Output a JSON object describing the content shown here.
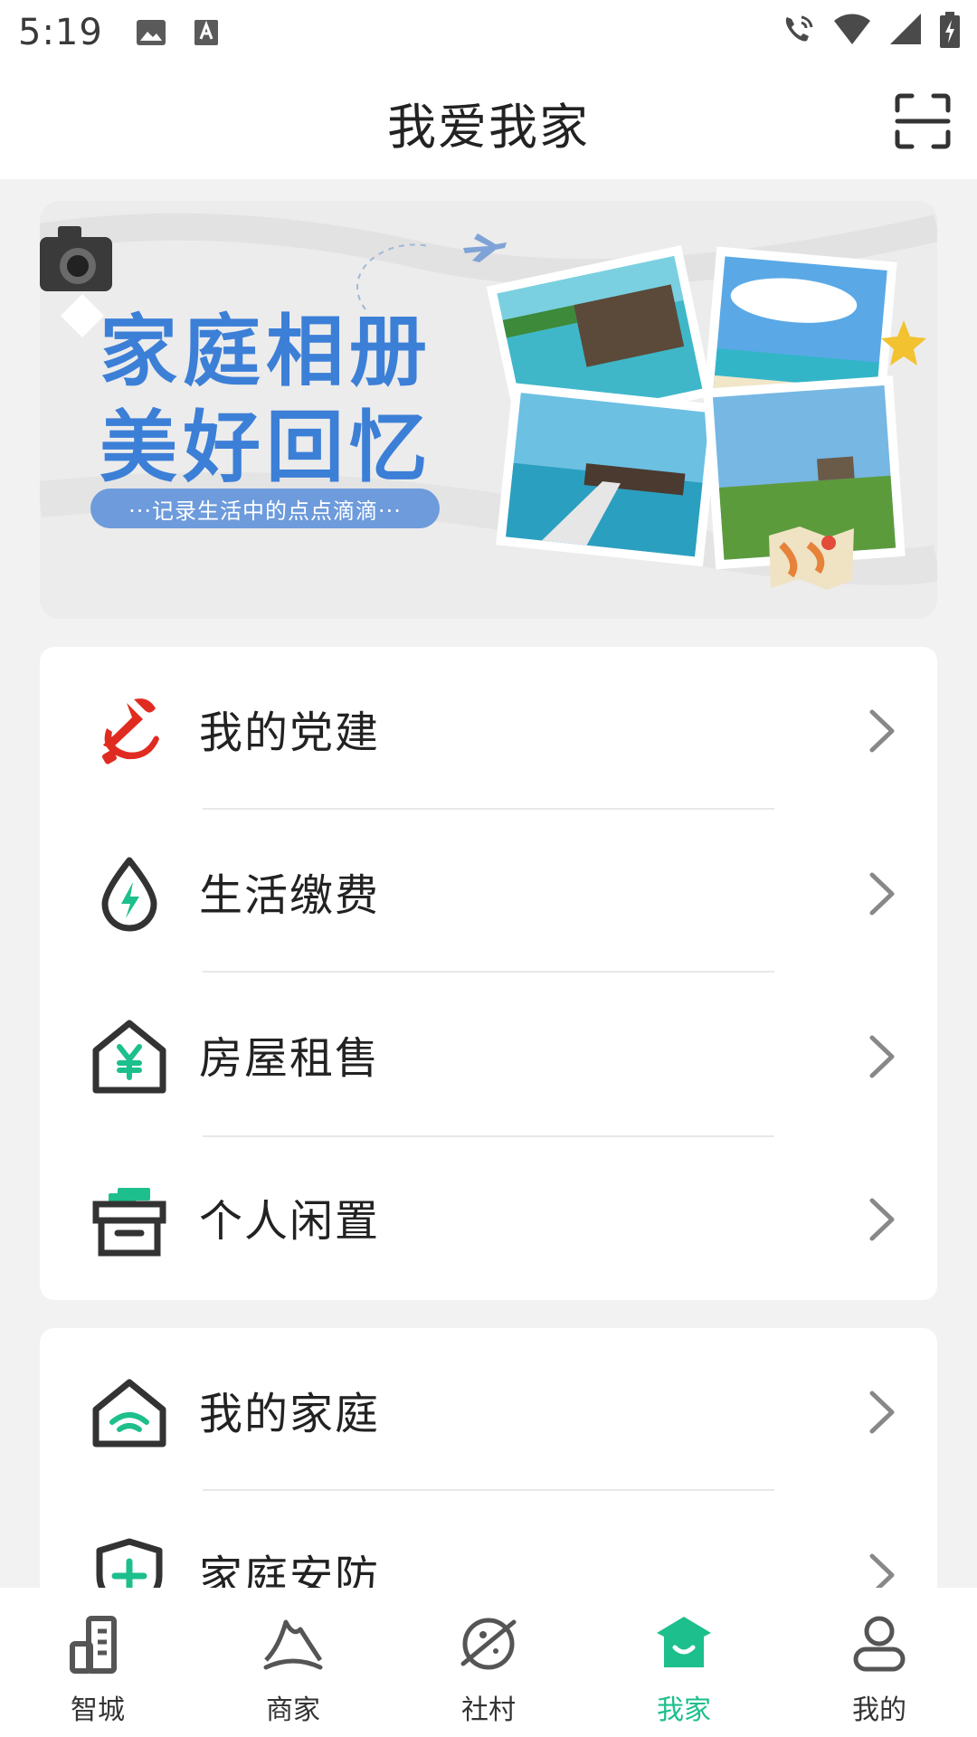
{
  "status_bar": {
    "time": "5:19",
    "icons_left": [
      "image-icon",
      "a-icon"
    ],
    "icons_right": [
      "wifi-call-icon",
      "wifi-icon",
      "signal-icon",
      "battery-icon"
    ]
  },
  "header": {
    "title": "我爱我家",
    "scan_icon": "scan-icon"
  },
  "banner": {
    "title_line1": "家庭相册",
    "title_line2": "美好回忆",
    "subtitle": "···记录生活中的点点滴滴···"
  },
  "menu_group1": [
    {
      "label": "我的党建",
      "icon": "party-icon",
      "color": "#e02b20"
    },
    {
      "label": "生活缴费",
      "icon": "water-drop-bolt-icon",
      "color": "#1dbf8c"
    },
    {
      "label": "房屋租售",
      "icon": "house-yuan-icon",
      "color": "#1dbf8c"
    },
    {
      "label": "个人闲置",
      "icon": "box-icon",
      "color": "#1dbf8c"
    }
  ],
  "menu_group2": [
    {
      "label": "我的家庭",
      "icon": "home-wifi-icon",
      "color": "#1dbf8c"
    },
    {
      "label": "家庭安防",
      "icon": "shield-plus-icon",
      "color": "#1dbf8c"
    }
  ],
  "tab_bar": {
    "active_color": "#1dbf8c",
    "tabs": [
      {
        "label": "智城",
        "icon": "city-icon",
        "active": false
      },
      {
        "label": "商家",
        "icon": "merchant-icon",
        "active": false
      },
      {
        "label": "社村",
        "icon": "planet-icon",
        "active": false
      },
      {
        "label": "我家",
        "icon": "my-home-icon",
        "active": true
      },
      {
        "label": "我的",
        "icon": "profile-icon",
        "active": false
      }
    ]
  }
}
